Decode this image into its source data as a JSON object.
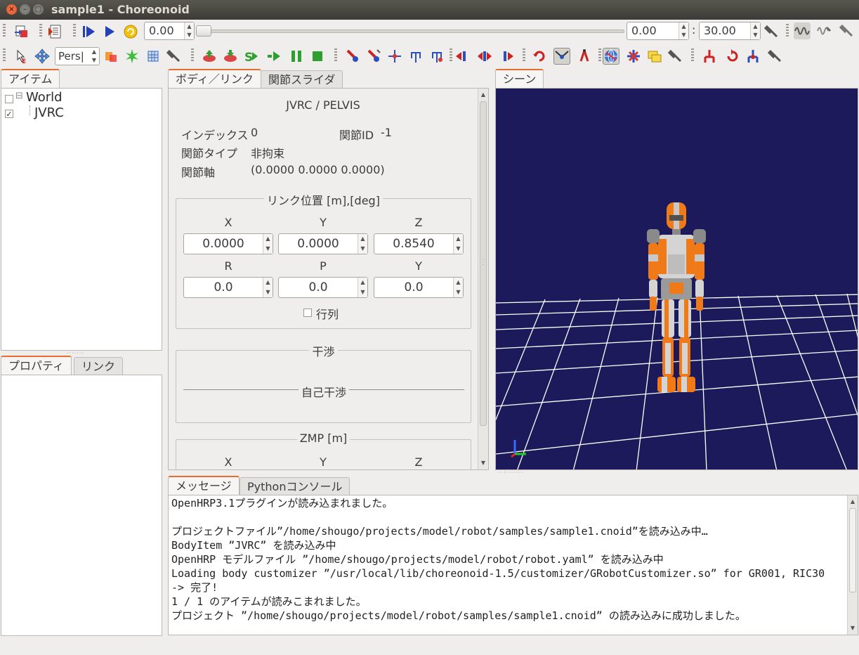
{
  "window": {
    "title": "sample1 - Choreonoid"
  },
  "toolbar1": {
    "time_value": "0.00",
    "range_start": "0.00",
    "range_sep": ":",
    "range_end": "30.00"
  },
  "toolbar2": {
    "view_mode": "Pers|"
  },
  "item_view": {
    "tab_label": "アイテム",
    "items": [
      {
        "label": "World",
        "checked": false
      },
      {
        "label": "JVRC",
        "checked": true
      }
    ]
  },
  "property_view": {
    "tabs": [
      "プロパティ",
      "リンク"
    ]
  },
  "body_link_view": {
    "tabs": [
      "ボディ／リンク",
      "関節スライダ"
    ],
    "header": "JVRC / PELVIS",
    "index_label": "インデックス",
    "index_value": "0",
    "joint_id_label": "関節ID",
    "joint_id_value": "-1",
    "joint_type_label": "関節タイプ",
    "joint_type_value": "非拘束",
    "joint_axis_label": "関節軸",
    "joint_axis_value": "(0.0000 0.0000 0.0000)",
    "link_pos_title": "リンク位置 [m],[deg]",
    "pos_labels": [
      "X",
      "Y",
      "Z"
    ],
    "pos_values": [
      "0.0000",
      "0.0000",
      "0.8540"
    ],
    "rot_labels": [
      "R",
      "P",
      "Y"
    ],
    "rot_values": [
      "0.0",
      "0.0",
      "0.0"
    ],
    "matrix_label": "行列",
    "collision_title": "干渉",
    "self_collision_title": "自己干渉",
    "zmp_title": "ZMP [m]",
    "zmp_labels": [
      "X",
      "Y",
      "Z"
    ]
  },
  "scene_view": {
    "tab_label": "シーン",
    "background": "#1c1a5a"
  },
  "message_view": {
    "tabs": [
      "メッセージ",
      "Pythonコンソール"
    ],
    "lines": [
      "OpenHRP3.1プラグインが読み込まれました。",
      "",
      "プロジェクトファイル”/home/shougo/projects/model/robot/samples/sample1.cnoid”を読み込み中…",
      "BodyItem ”JVRC” を読み込み中",
      "OpenHRP モデルファイル ”/home/shougo/projects/model/robot/robot.yaml” を読み込み中",
      "Loading body customizer ”/usr/local/lib/choreonoid-1.5/customizer/GRobotCustomizer.so” for GR001, RIC30",
      "-> 完了!",
      "1 / 1 のアイテムが読みこまれました。",
      "プロジェクト ”/home/shougo/projects/model/robot/samples/sample1.cnoid” の読み込みに成功しました。"
    ]
  },
  "colors": {
    "accent": "#e86e2c",
    "scene_grid": "#ffffff",
    "robot_orange": "#f07a18",
    "robot_grey": "#a8a8a8"
  }
}
